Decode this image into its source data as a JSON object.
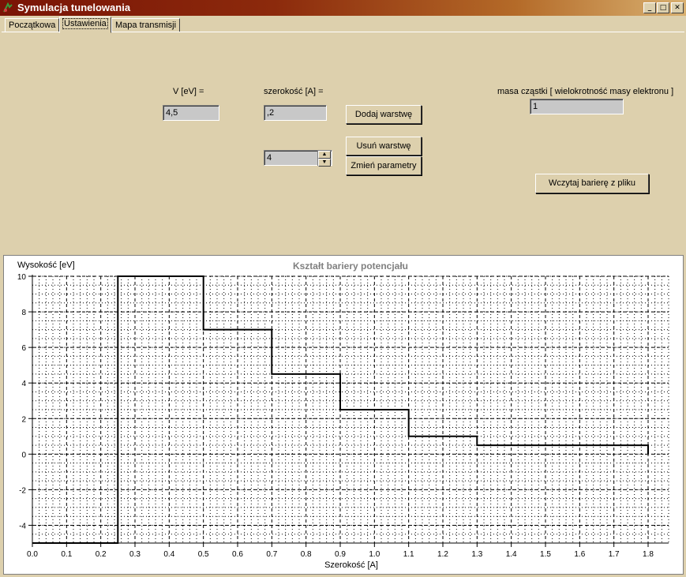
{
  "window": {
    "title": "Symulacja tunelowania"
  },
  "tabs": [
    "Początkowa",
    "Ustawienia",
    "Mapa transmisji"
  ],
  "form": {
    "v_label": "V [eV] =",
    "v_value": "4,5",
    "width_label": "szerokość [A] =",
    "width_value": ",2",
    "spin_value": "4",
    "mass_label": "masa cząstki [ wielokrotność masy elektronu ]",
    "mass_value": "1",
    "add_layer": "Dodaj warstwę",
    "remove_layer": "Usuń warstwę",
    "change_params": "Zmień parametry",
    "load_file": "Wczytaj barierę z pliku"
  },
  "chart_data": {
    "type": "line",
    "title": "Kształt bariery potencjału",
    "xlabel": "Szerokość [A]",
    "ylabel": "Wysokość [eV]",
    "xlim": [
      0.0,
      1.86
    ],
    "ylim": [
      -5,
      10
    ],
    "x_ticks": [
      "0.0",
      "0.1",
      "0.2",
      "0.3",
      "0.4",
      "0.5",
      "0.6",
      "0.7",
      "0.8",
      "0.9",
      "1.0",
      "1.1",
      "1.2",
      "1.3",
      "1.4",
      "1.5",
      "1.6",
      "1.7",
      "1.8"
    ],
    "y_ticks": [
      "10",
      "8",
      "6",
      "4",
      "2",
      "0",
      "-2",
      "-4"
    ],
    "grid": true,
    "series": [
      {
        "x": [
          0.0,
          0.25,
          0.25,
          0.5,
          0.5,
          0.7,
          0.7,
          0.9,
          0.9,
          1.1,
          1.1,
          1.3,
          1.3,
          1.8,
          1.8
        ],
        "y": [
          -5,
          -5,
          10,
          10,
          7,
          7,
          4.5,
          4.5,
          2.5,
          2.5,
          1,
          1,
          0.5,
          0.5,
          0
        ]
      }
    ]
  }
}
